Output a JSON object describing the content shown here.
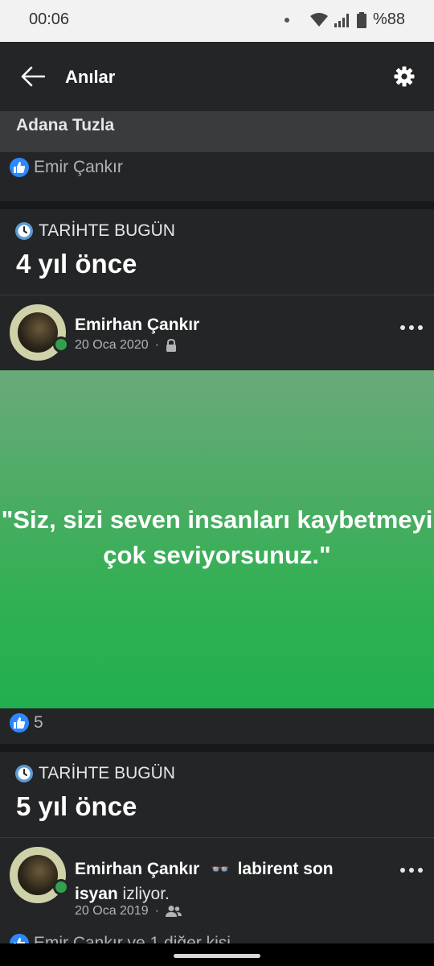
{
  "status_bar": {
    "time": "00:06",
    "battery": "%88"
  },
  "app_bar": {
    "title": "Anılar"
  },
  "previous_post": {
    "location": "Adana Tuzla",
    "reaction_name": "Emir Çankır"
  },
  "memory1": {
    "section_label": "TARİHTE BUGÜN",
    "years_ago": "4 yıl önce",
    "author": "Emirhan Çankır",
    "date": "20 Oca 2020",
    "dot": "·",
    "quote": "\"Siz, sizi seven insanları kaybetmeyi çok seviyorsunuz.\"",
    "quote_bg_start": "#6aaa7c",
    "quote_bg_end": "#22af50",
    "like_count": "5"
  },
  "memory2": {
    "section_label": "TARİHTE BUGÜN",
    "years_ago": "5 yıl önce",
    "author": "Emirhan Çankır",
    "activity_emoji": "👓",
    "activity_bold": "labirent son",
    "activity_bold2": "isyan",
    "activity_tail": "izliyor.",
    "date": "20 Oca 2019",
    "dot": "·",
    "reaction_text": "Emir Çankır ve 1 diğer kişi"
  },
  "colors": {
    "accent": "#2d88ff",
    "online": "#31a24c",
    "bg": "#18191a",
    "card": "#242526"
  }
}
